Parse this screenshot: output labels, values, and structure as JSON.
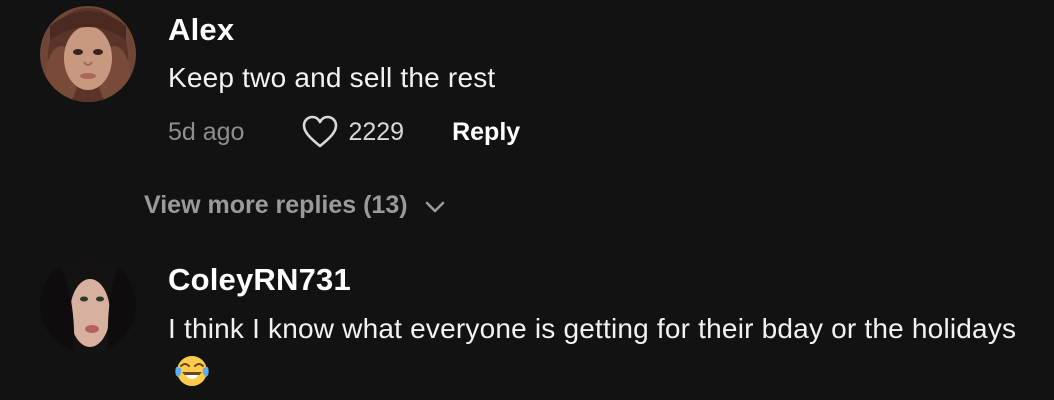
{
  "comments": [
    {
      "username": "Alex",
      "text": "Keep two and sell the rest",
      "time": "5d ago",
      "likes": "2229",
      "reply_label": "Reply"
    },
    {
      "username": "ColeyRN731",
      "text": "I think I know what everyone is getting for their bday or the holidays",
      "emoji": "face-with-tears-of-joy-icon"
    }
  ],
  "view_more_label": "View more replies (13)",
  "icons": {
    "like": "heart-outline-icon",
    "expand": "chevron-down-icon"
  },
  "colors": {
    "background": "#121212",
    "primary_text": "#ffffff",
    "secondary_text": "#8e8e8e"
  }
}
